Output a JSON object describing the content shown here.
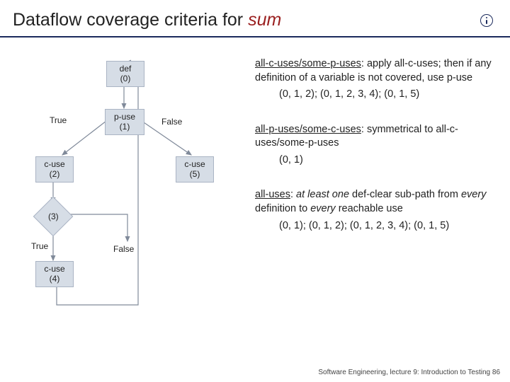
{
  "header": {
    "title_prefix": "Dataflow coverage criteria for ",
    "title_em": "sum"
  },
  "diagram": {
    "nodes": {
      "def": "def\n(0)",
      "puse": "p-use\n(1)",
      "cuse2": "c-use\n(2)",
      "cuse5": "c-use\n(5)",
      "n3": "(3)",
      "cuse4": "c-use\n(4)"
    },
    "labels": {
      "true_top": "True",
      "false_top": "False",
      "true_mid": "True",
      "false_mid": "False"
    }
  },
  "blocks": {
    "b1": {
      "head": "all-c-uses/some-p-uses",
      "desc": ": apply all-c-uses; then if any definition of a variable is not covered, use p-use",
      "list": "(0, 1, 2); (0, 1, 2, 3, 4); (0, 1, 5)"
    },
    "b2": {
      "head": "all-p-uses/some-c-uses",
      "desc": ": symmetrical to all-c-uses/some-p-uses",
      "list": "(0, 1)"
    },
    "b3": {
      "head": "all-uses",
      "desc_pre": ": ",
      "em1": "at least one",
      "mid1": " def-clear sub-path from ",
      "em2": "every",
      "mid2": " definition to ",
      "em3": "every",
      "mid3": " reachable use",
      "list": "(0, 1); (0, 1, 2); (0, 1, 2, 3, 4); (0, 1, 5)"
    }
  },
  "footer": "Software Engineering, lecture 9: Introduction to Testing   86"
}
